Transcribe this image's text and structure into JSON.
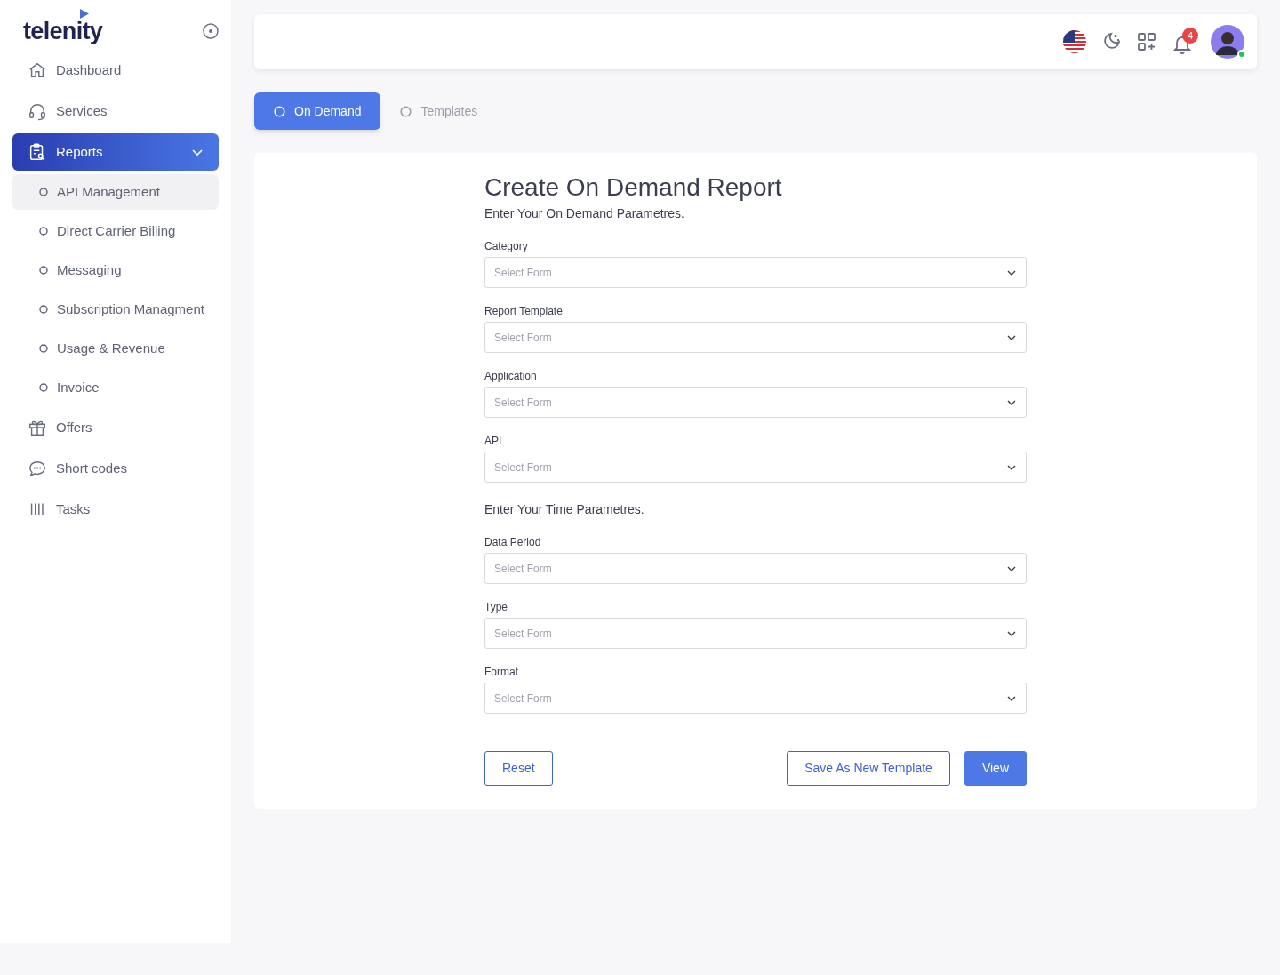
{
  "logo": "telenity",
  "sidebar": {
    "items": [
      {
        "label": "Dashboard",
        "selected": false
      },
      {
        "label": "Services",
        "selected": false
      },
      {
        "label": "Reports",
        "selected": true,
        "expanded": true,
        "children": [
          {
            "label": "API Management",
            "selected": true
          },
          {
            "label": "Direct Carrier Billing",
            "selected": false
          },
          {
            "label": "Messaging",
            "selected": false
          },
          {
            "label": "Subscription Managment",
            "selected": false
          },
          {
            "label": "Usage & Revenue",
            "selected": false
          },
          {
            "label": "Invoice",
            "selected": false
          }
        ]
      },
      {
        "label": "Offers",
        "selected": false
      },
      {
        "label": "Short codes",
        "selected": false
      },
      {
        "label": "Tasks",
        "selected": false
      }
    ]
  },
  "topbar": {
    "notification_count": "4",
    "online": true
  },
  "tabs": [
    {
      "label": "On Demand",
      "selected": true
    },
    {
      "label": "Templates",
      "selected": false
    }
  ],
  "form": {
    "title": "Create On Demand Report",
    "subtitle": "Enter Your On Demand Parametres.",
    "rows": [
      {
        "kind": "select",
        "label": "Category",
        "placeholder": "Select Form"
      },
      {
        "kind": "select",
        "label": "Report Template",
        "placeholder": "Select Form"
      },
      {
        "kind": "select",
        "label": "Application",
        "placeholder": "Select Form"
      },
      {
        "kind": "select",
        "label": "API",
        "placeholder": "Select Form"
      },
      {
        "kind": "heading",
        "text": "Enter Your Time Parametres."
      },
      {
        "kind": "select",
        "label": "Data Period",
        "placeholder": "Select Form"
      },
      {
        "kind": "select",
        "label": "Type",
        "placeholder": "Select Form"
      },
      {
        "kind": "select",
        "label": "Format",
        "placeholder": "Select Form"
      }
    ],
    "buttons": [
      {
        "label": "Reset",
        "kind": "outline"
      },
      {
        "label": "Save As New Template",
        "kind": "outline"
      },
      {
        "label": "View",
        "kind": "primary"
      }
    ]
  }
}
